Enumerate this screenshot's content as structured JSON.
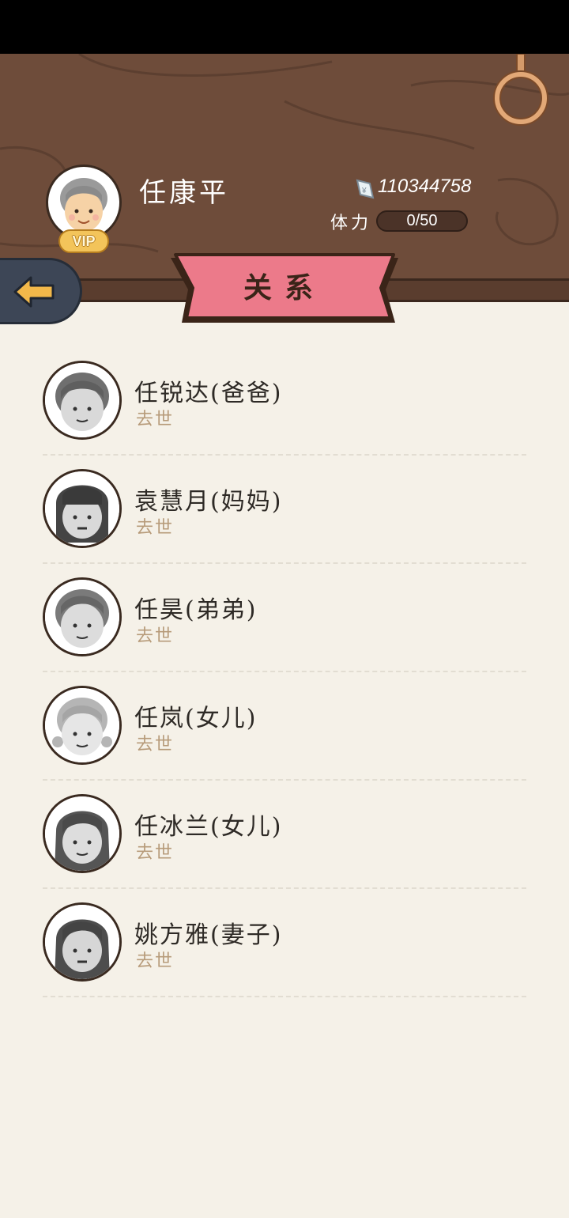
{
  "player": {
    "name": "任康平",
    "vip_label": "VIP",
    "money": "110344758",
    "stamina_label": "体力",
    "stamina_text": "0/50",
    "stamina_fraction": 0
  },
  "page": {
    "title": "关系"
  },
  "relations": [
    {
      "name": "任锐达(爸爸)",
      "status": "去世"
    },
    {
      "name": "袁慧月(妈妈)",
      "status": "去世"
    },
    {
      "name": "任昊(弟弟)",
      "status": "去世"
    },
    {
      "name": "任岚(女儿)",
      "status": "去世"
    },
    {
      "name": "任冰兰(女儿)",
      "status": "去世"
    },
    {
      "name": "姚方雅(妻子)",
      "status": "去世"
    }
  ],
  "icons": {
    "back": "arrow-left-icon",
    "money": "banknote-icon",
    "settings_ring": "ring-pendant-icon"
  },
  "colors": {
    "header_wood": "#6e4c3a",
    "banner_pink": "#ec7a8a",
    "page_bg": "#f5f1e8",
    "status_text": "#b79b7a"
  }
}
